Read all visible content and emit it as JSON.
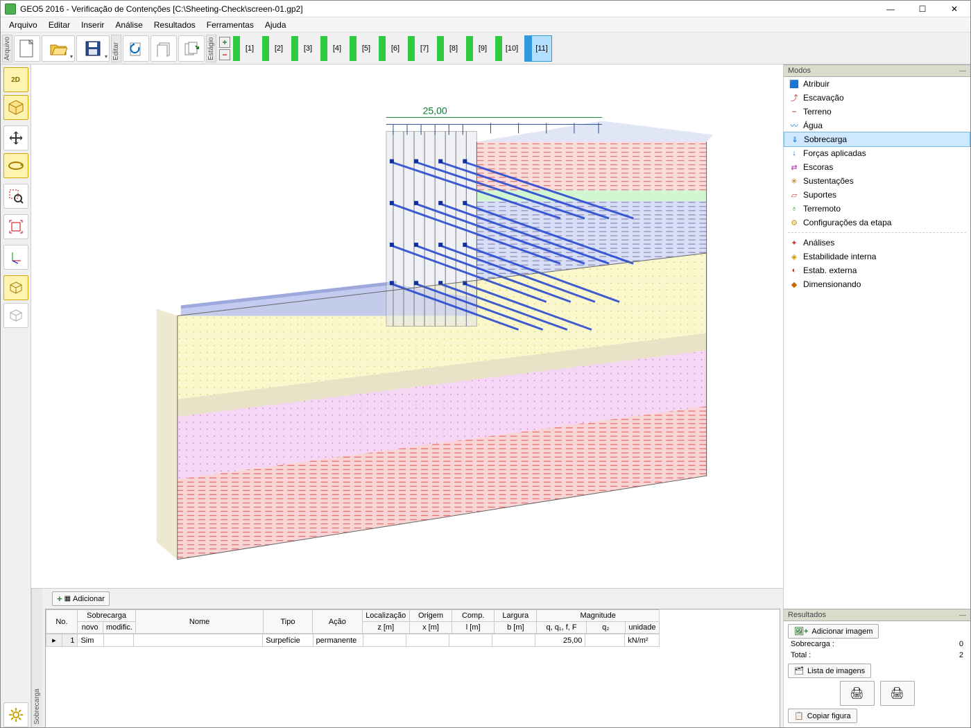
{
  "window": {
    "title": "GEO5 2016 - Verificação de Contenções [C:\\Sheeting-Check\\screen-01.gp2]"
  },
  "menu": [
    "Arquivo",
    "Editar",
    "Inserir",
    "Análise",
    "Resultados",
    "Ferramentas",
    "Ajuda"
  ],
  "toolbar": {
    "group_file": "Arquivo",
    "group_edit": "Editar",
    "group_stage": "Estágio",
    "stages": [
      "[1]",
      "[2]",
      "[3]",
      "[4]",
      "[5]",
      "[6]",
      "[7]",
      "[8]",
      "[9]",
      "[10]",
      "[11]"
    ],
    "current_stage": 10
  },
  "lefttools": {
    "b2d": "2D",
    "b3d": "3D"
  },
  "viewport": {
    "dim_top": "25,00"
  },
  "modes_panel": {
    "title": "Modos",
    "items": [
      "Atribuir",
      "Escavação",
      "Terreno",
      "Água",
      "Sobrecarga",
      "Forças aplicadas",
      "Escoras",
      "Sustentações",
      "Suportes",
      "Terremoto",
      "Configurações da etapa"
    ],
    "selected": 4,
    "items2": [
      "Análises",
      "Estabilidade interna",
      "Estab. externa",
      "Dimensionando"
    ]
  },
  "results_panel": {
    "title": "Resultados",
    "add_image": "Adicionar imagem",
    "line1_l": "Sobrecarga :",
    "line1_r": "0",
    "line2_l": "Total :",
    "line2_r": "2",
    "list_images": "Lista de imagens",
    "copy": "Copiar figura"
  },
  "bottom": {
    "vlabel": "Sobrecarga",
    "add": "Adicionar",
    "headers": {
      "no": "No.",
      "sobrecarga": "Sobrecarga",
      "novo": "novo",
      "mod": "modific.",
      "nome": "Nome",
      "tipo": "Tipo",
      "acao": "Ação",
      "loc": "Localização",
      "z": "z [m]",
      "origem": "Origem",
      "x": "x [m]",
      "comp": "Comp.",
      "l": "l [m]",
      "largura": "Largura",
      "b": "b [m]",
      "magnitude": "Magnitude",
      "q1": "q, q₁, f, F",
      "q2": "q₂",
      "un": "unidade"
    },
    "row": {
      "idx": "1",
      "novo": "Sim",
      "tipo": "Surpefície",
      "acao": "permanente",
      "q1": "25,00",
      "un": "kN/m²"
    }
  }
}
